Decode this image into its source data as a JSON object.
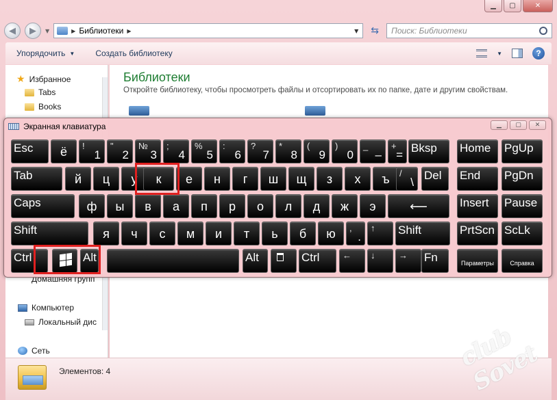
{
  "explorer": {
    "address": {
      "path": "Библиотеки"
    },
    "search": {
      "placeholder": "Поиск: Библиотеки"
    },
    "toolbar": {
      "organize": "Упорядочить",
      "new_library": "Создать библиотеку"
    },
    "nav": {
      "favorites": "Избранное",
      "tabs": "Tabs",
      "books": "Books",
      "homegroup": "Домашняя групп",
      "computer": "Компьютер",
      "local_disk": "Локальный дис",
      "network": "Сеть"
    },
    "content": {
      "title": "Библиотеки",
      "description": "Откройте библиотеку, чтобы просмотреть файлы и отсортировать их по папке, дате и другим свойствам."
    },
    "status": {
      "items": "Элементов: 4"
    },
    "watermark": "club Sovet"
  },
  "osk": {
    "title": "Экранная клавиатура",
    "keys": [
      {
        "id": "esc",
        "label": "Esc"
      },
      {
        "id": "yo",
        "label": "ё"
      },
      {
        "id": "1",
        "top": "!",
        "bot": "1"
      },
      {
        "id": "2",
        "top": "\"",
        "bot": "2"
      },
      {
        "id": "3",
        "top": "№",
        "bot": "3"
      },
      {
        "id": "4",
        "top": ";",
        "bot": "4"
      },
      {
        "id": "5",
        "top": "%",
        "bot": "5"
      },
      {
        "id": "6",
        "top": ":",
        "bot": "6"
      },
      {
        "id": "7",
        "top": "?",
        "bot": "7"
      },
      {
        "id": "8",
        "top": "*",
        "bot": "8"
      },
      {
        "id": "9",
        "top": "(",
        "bot": "9"
      },
      {
        "id": "0",
        "top": ")",
        "bot": "0"
      },
      {
        "id": "minus",
        "top": "_",
        "bot": "–"
      },
      {
        "id": "plus",
        "top": "+",
        "bot": "="
      },
      {
        "id": "bksp",
        "label": "Bksp"
      },
      {
        "id": "home",
        "label": "Home"
      },
      {
        "id": "pgup",
        "label": "PgUp"
      },
      {
        "id": "tab",
        "label": "Tab"
      },
      {
        "id": "y",
        "label": "й"
      },
      {
        "id": "ts",
        "label": "ц"
      },
      {
        "id": "u",
        "label": "у"
      },
      {
        "id": "k",
        "label": "к"
      },
      {
        "id": "e",
        "label": "е"
      },
      {
        "id": "n",
        "label": "н"
      },
      {
        "id": "g",
        "label": "г"
      },
      {
        "id": "sh",
        "label": "ш"
      },
      {
        "id": "shch",
        "label": "щ"
      },
      {
        "id": "z",
        "label": "з"
      },
      {
        "id": "h",
        "label": "х"
      },
      {
        "id": "hard",
        "label": "ъ"
      },
      {
        "id": "bslash",
        "top": "/",
        "bot": "\\"
      },
      {
        "id": "del",
        "label": "Del"
      },
      {
        "id": "end",
        "label": "End"
      },
      {
        "id": "pgdn",
        "label": "PgDn"
      },
      {
        "id": "caps",
        "label": "Caps"
      },
      {
        "id": "f",
        "label": "ф"
      },
      {
        "id": "yy",
        "label": "ы"
      },
      {
        "id": "v",
        "label": "в"
      },
      {
        "id": "a",
        "label": "а"
      },
      {
        "id": "p",
        "label": "п"
      },
      {
        "id": "r",
        "label": "р"
      },
      {
        "id": "o",
        "label": "о"
      },
      {
        "id": "l",
        "label": "л"
      },
      {
        "id": "d",
        "label": "д"
      },
      {
        "id": "zh",
        "label": "ж"
      },
      {
        "id": "ee",
        "label": "э"
      },
      {
        "id": "enter",
        "label": "⟵"
      },
      {
        "id": "insert",
        "label": "Insert"
      },
      {
        "id": "pause",
        "label": "Pause"
      },
      {
        "id": "lshift",
        "label": "Shift"
      },
      {
        "id": "ya",
        "label": "я"
      },
      {
        "id": "ch",
        "label": "ч"
      },
      {
        "id": "s",
        "label": "с"
      },
      {
        "id": "m",
        "label": "м"
      },
      {
        "id": "i",
        "label": "и"
      },
      {
        "id": "t",
        "label": "т"
      },
      {
        "id": "soft",
        "label": "ь"
      },
      {
        "id": "b",
        "label": "б"
      },
      {
        "id": "yu",
        "label": "ю"
      },
      {
        "id": "dot",
        "top": ",",
        "bot": "."
      },
      {
        "id": "up",
        "top": "↑",
        "bot": ""
      },
      {
        "id": "rshift",
        "label": "Shift"
      },
      {
        "id": "prtscn",
        "label": "PrtScn"
      },
      {
        "id": "sclk",
        "label": "ScLk"
      },
      {
        "id": "lctrl",
        "label": "Ctrl"
      },
      {
        "id": "win",
        "label": ""
      },
      {
        "id": "lalt",
        "label": "Alt"
      },
      {
        "id": "space",
        "label": ""
      },
      {
        "id": "ralt",
        "label": "Alt"
      },
      {
        "id": "menu",
        "label": ""
      },
      {
        "id": "rctrl",
        "label": "Ctrl"
      },
      {
        "id": "left",
        "top": "←",
        "bot": ""
      },
      {
        "id": "down",
        "top": "↓",
        "bot": ""
      },
      {
        "id": "right",
        "top": "→",
        "bot": ""
      },
      {
        "id": "fn",
        "label": "Fn"
      },
      {
        "id": "options",
        "label": "Параметры"
      },
      {
        "id": "help",
        "label": "Справка"
      }
    ]
  }
}
